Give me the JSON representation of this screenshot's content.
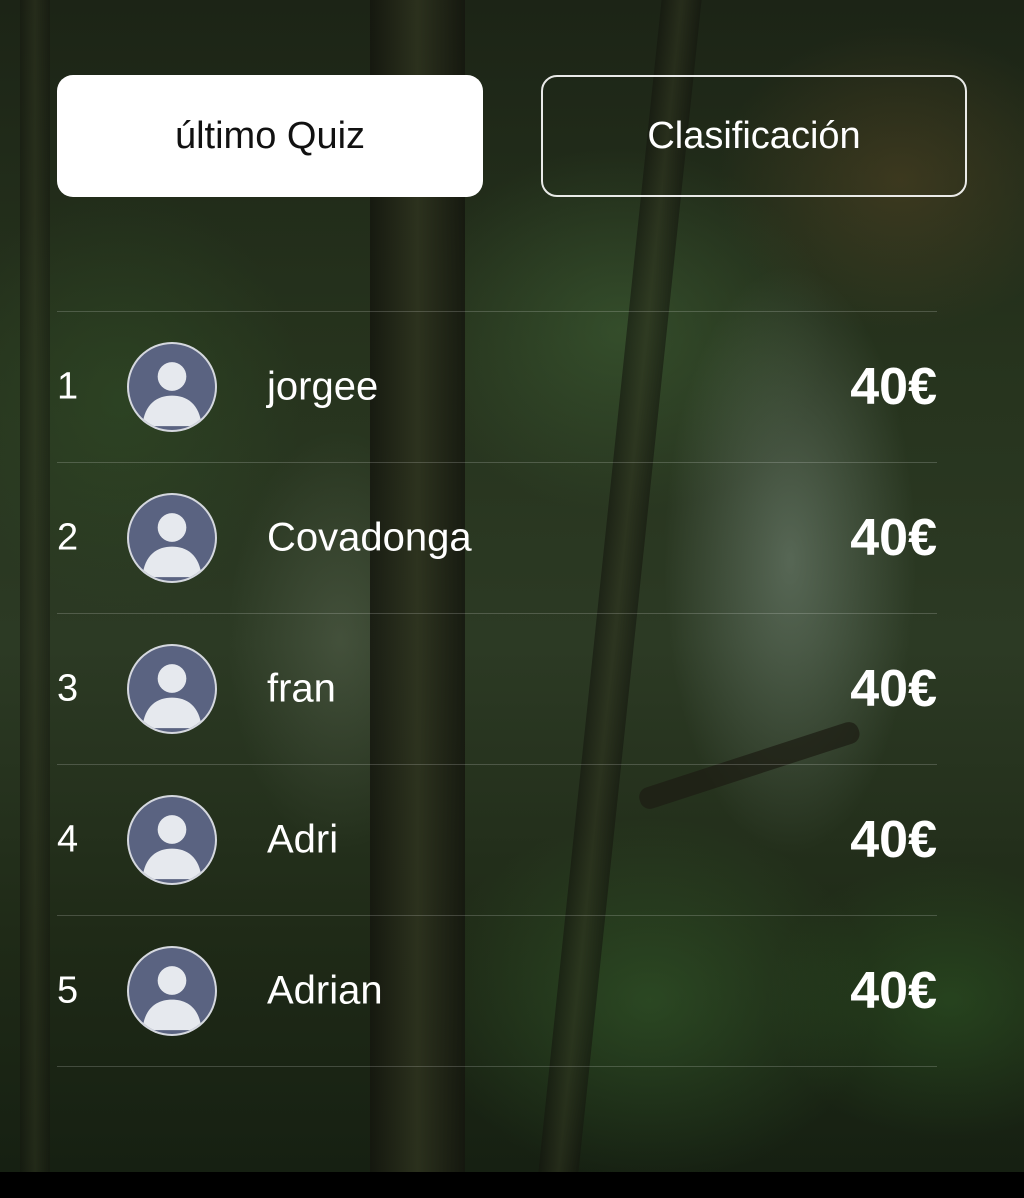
{
  "tabs": {
    "last_quiz": "último Quiz",
    "ranking": "Clasificación"
  },
  "leaderboard": [
    {
      "rank": "1",
      "name": "jorgee",
      "score": "40€"
    },
    {
      "rank": "2",
      "name": "Covadonga",
      "score": "40€"
    },
    {
      "rank": "3",
      "name": "fran",
      "score": "40€"
    },
    {
      "rank": "4",
      "name": "Adri",
      "score": "40€"
    },
    {
      "rank": "5",
      "name": "Adrian",
      "score": "40€"
    }
  ],
  "colors": {
    "active_tab_bg": "#ffffff",
    "avatar_bg": "#5a6381",
    "avatar_silhouette": "#e6e9ee"
  },
  "icons": {
    "avatar": "user-placeholder-icon"
  }
}
